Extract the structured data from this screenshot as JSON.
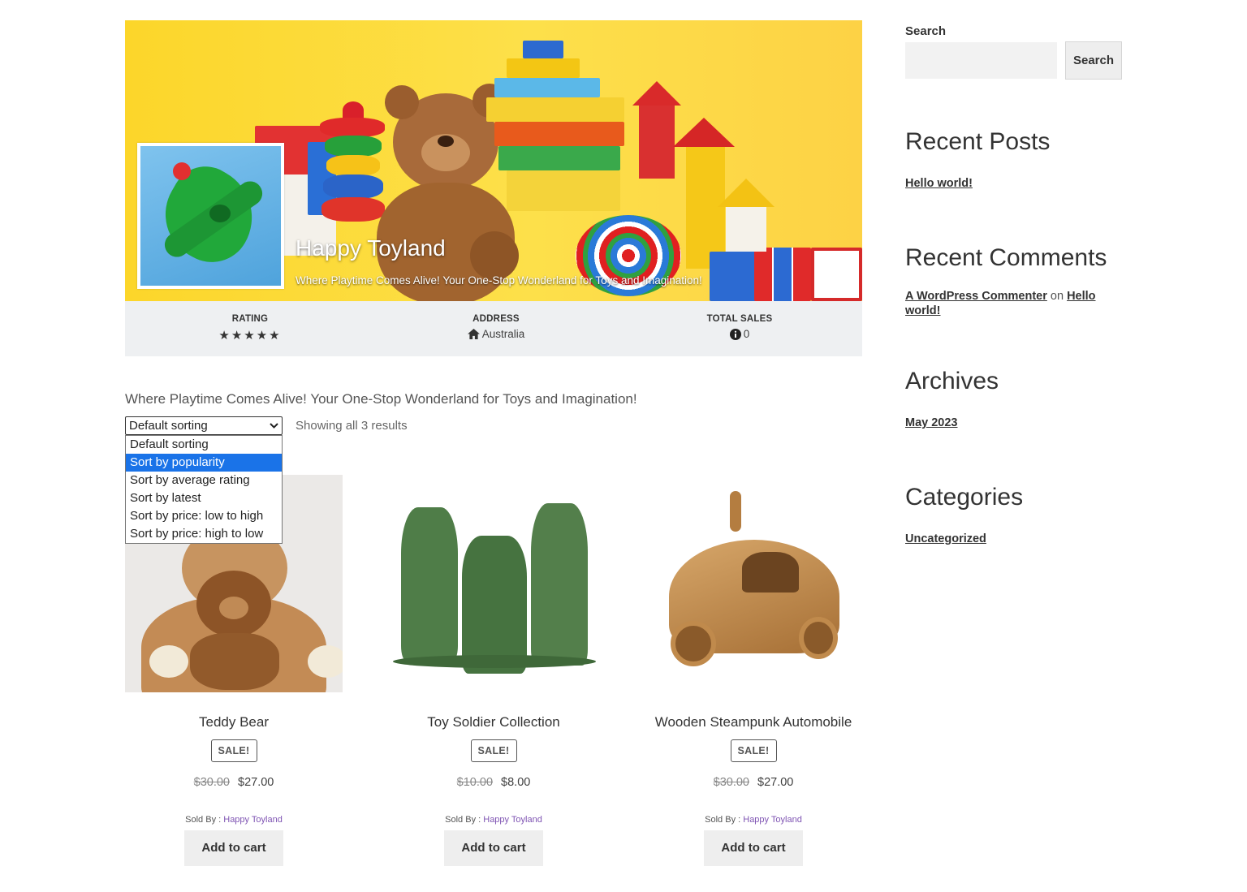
{
  "store": {
    "name": "Happy Toyland",
    "tagline": "Where Playtime Comes Alive! Your One-Stop Wonderland for Toys and Imagination!"
  },
  "info": {
    "rating_label": "RATING",
    "rating_stars": "★★★★★",
    "rating_value": 5,
    "address_label": "ADDRESS",
    "address_value": "Australia",
    "sales_label": "TOTAL SALES",
    "sales_value": "0"
  },
  "description": "Where Playtime Comes Alive! Your One-Stop Wonderland for Toys and Imagination!",
  "sorting": {
    "selected": "Default sorting",
    "highlighted": "Sort by popularity",
    "options": [
      "Default sorting",
      "Sort by popularity",
      "Sort by average rating",
      "Sort by latest",
      "Sort by price: low to high",
      "Sort by price: high to low"
    ]
  },
  "result_count": "Showing all 3 results",
  "products": [
    {
      "title": "Teddy Bear",
      "badge": "SALE!",
      "old_price": "$30.00",
      "price": "$27.00",
      "sold_by_label": "Sold By :",
      "vendor": "Happy Toyland",
      "button": "Add to cart"
    },
    {
      "title": "Toy Soldier Collection",
      "badge": "SALE!",
      "old_price": "$10.00",
      "price": "$8.00",
      "sold_by_label": "Sold By :",
      "vendor": "Happy Toyland",
      "button": "Add to cart"
    },
    {
      "title": "Wooden Steampunk Automobile",
      "badge": "SALE!",
      "old_price": "$30.00",
      "price": "$27.00",
      "sold_by_label": "Sold By :",
      "vendor": "Happy Toyland",
      "button": "Add to cart"
    }
  ],
  "sidebar": {
    "search_label": "Search",
    "search_button": "Search",
    "recent_posts_title": "Recent Posts",
    "recent_posts": [
      "Hello world!"
    ],
    "recent_comments_title": "Recent Comments",
    "comment": {
      "author": "A WordPress Commenter",
      "on": "on",
      "post": "Hello world!"
    },
    "archives_title": "Archives",
    "archives": [
      "May 2023"
    ],
    "categories_title": "Categories",
    "categories": [
      "Uncategorized"
    ]
  },
  "icons": {
    "home": "home-icon",
    "info": "info-circle-icon",
    "chevron": "chevron-down-icon"
  },
  "colors": {
    "banner_yellow": "#fcd62a",
    "vendor_link": "#7f54b3",
    "selected_option": "#1a73e8"
  }
}
